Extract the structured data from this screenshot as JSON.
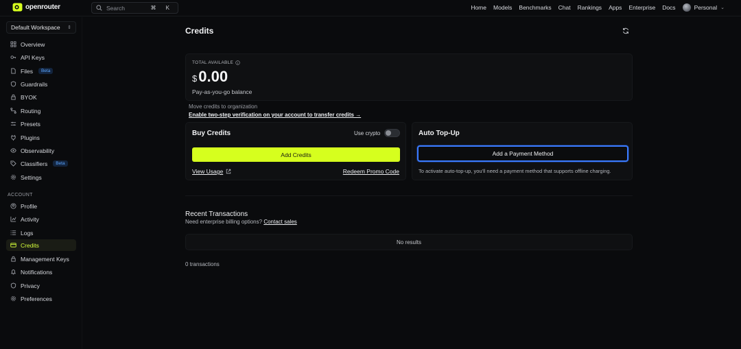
{
  "header": {
    "brand": "openrouter",
    "search": {
      "placeholder": "Search",
      "shortcut": "⌘ K"
    },
    "nav": [
      "Home",
      "Models",
      "Benchmarks",
      "Chat",
      "Rankings",
      "Apps",
      "Enterprise",
      "Docs"
    ],
    "account": "Personal"
  },
  "sidebar": {
    "workspace": "Default Workspace",
    "items": [
      {
        "label": "Overview",
        "icon": "grid-icon"
      },
      {
        "label": "API Keys",
        "icon": "key-icon"
      },
      {
        "label": "Files",
        "icon": "file-icon",
        "badge": "Beta"
      },
      {
        "label": "Guardrails",
        "icon": "shield-icon"
      },
      {
        "label": "BYOK",
        "icon": "lock-icon"
      },
      {
        "label": "Routing",
        "icon": "route-icon"
      },
      {
        "label": "Presets",
        "icon": "sliders-icon"
      },
      {
        "label": "Plugins",
        "icon": "plug-icon"
      },
      {
        "label": "Observability",
        "icon": "eye-icon"
      },
      {
        "label": "Classifiers",
        "icon": "tag-icon",
        "badge": "Beta"
      },
      {
        "label": "Settings",
        "icon": "gear-icon"
      }
    ],
    "account_section": "ACCOUNT",
    "account_items": [
      {
        "label": "Profile",
        "icon": "user-icon"
      },
      {
        "label": "Activity",
        "icon": "activity-icon"
      },
      {
        "label": "Logs",
        "icon": "list-icon"
      },
      {
        "label": "Credits",
        "icon": "card-icon",
        "active": true
      },
      {
        "label": "Management Keys",
        "icon": "lock-icon"
      },
      {
        "label": "Notifications",
        "icon": "bell-icon"
      },
      {
        "label": "Privacy",
        "icon": "shield-icon"
      },
      {
        "label": "Preferences",
        "icon": "gear-icon"
      }
    ]
  },
  "main": {
    "title": "Credits",
    "balance": {
      "label": "TOTAL AVAILABLE",
      "currency": "$",
      "amount": "0.00",
      "sub": "Pay-as-you-go balance"
    },
    "move_label": "Move credits to organization",
    "enable_link": "Enable two-step verification on your account to transfer credits →",
    "buy": {
      "title": "Buy Credits",
      "crypto_label": "Use crypto",
      "crypto_enabled": false,
      "add_button": "Add Credits",
      "view_usage": "View Usage",
      "promo": "Redeem Promo Code"
    },
    "topup": {
      "title": "Auto Top-Up",
      "button": "Add a Payment Method",
      "note": "To activate auto-top-up, you'll need a payment method that supports offline charging."
    },
    "recent": {
      "title": "Recent Transactions",
      "enterprise_prefix": "Need enterprise billing options?",
      "enterprise_link": "Contact sales",
      "empty": "No results",
      "count": "0 transactions"
    }
  },
  "colors": {
    "accent": "#d6ff1e",
    "focus": "#3a7bff",
    "background": "#0a0b0d"
  }
}
